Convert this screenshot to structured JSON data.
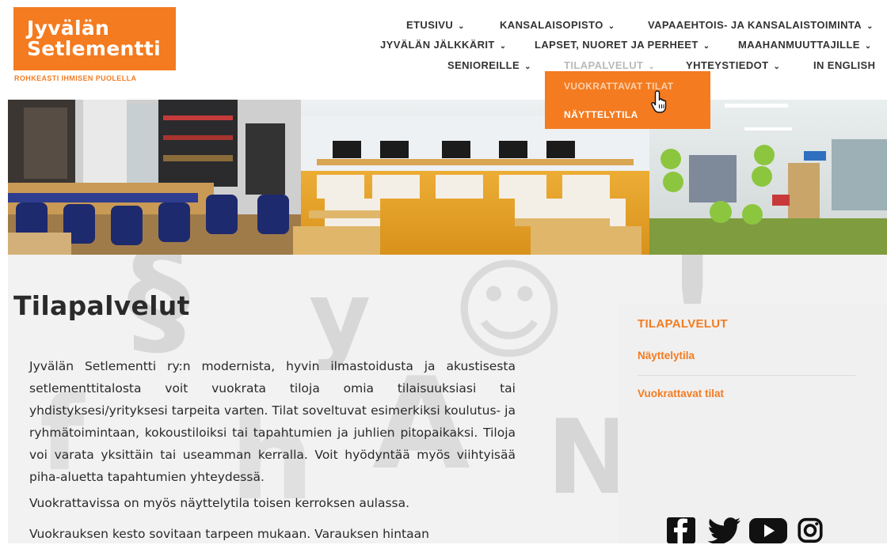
{
  "brand": {
    "logo_line1": "Jyvälän",
    "logo_line2": "Setlementti",
    "tagline": "ROHKEASTI IHMISEN PUOLELLA",
    "accent": "#f47b20"
  },
  "nav": {
    "row1": [
      "ETUSIVU",
      "KANSALAISOPISTO",
      "VAPAAEHTOIS- JA KANSALAISTOIMINTA"
    ],
    "row2": [
      "JYVÄLÄN JÄLKKÄRIT",
      "LAPSET, NUORET JA PERHEET",
      "MAAHANMUUTTAJILLE"
    ],
    "row3": [
      "SENIOREILLE",
      "TILAPALVELUT",
      "YHTEYSTIEDOT",
      "IN ENGLISH"
    ],
    "chevron_icon": "chevron-down-icon",
    "dropdown": [
      "VUOKRATTAVAT TILAT",
      "NÄYTTELYTILA"
    ]
  },
  "page": {
    "title": "Tilapalvelut",
    "paragraphs": [
      "Jyvälän Setlementti ry:n modernista, hyvin ilmastoidusta ja akustisesta setlementtitalosta voit vuokrata tiloja omia tilaisuuksiasi tai yhdistyksesi/yrityksesi tarpeita varten. Tilat soveltuvat esimerkiksi koulutus- ja ryhmätoimintaan, kokoustiloiksi tai tapahtumien ja juhlien pitopaikaksi. Tiloja voi varata yksittäin tai useamman kerralla. Voit hyödyntää myös viihtyisää piha-aluetta tapahtumien yhteydessä.",
      "Vuokrattavissa on myös näyttelytila toisen kerroksen aulassa.",
      "Vuokrauksen kesto sovitaan tarpeen mukaan. Varauksen hintaan"
    ]
  },
  "sidebar": {
    "heading": "TILAPALVELUT",
    "links": [
      "Näyttelytila",
      "Vuokrattavat tilat"
    ]
  },
  "social": [
    "facebook-icon",
    "twitter-icon",
    "youtube-icon",
    "instagram-icon"
  ]
}
